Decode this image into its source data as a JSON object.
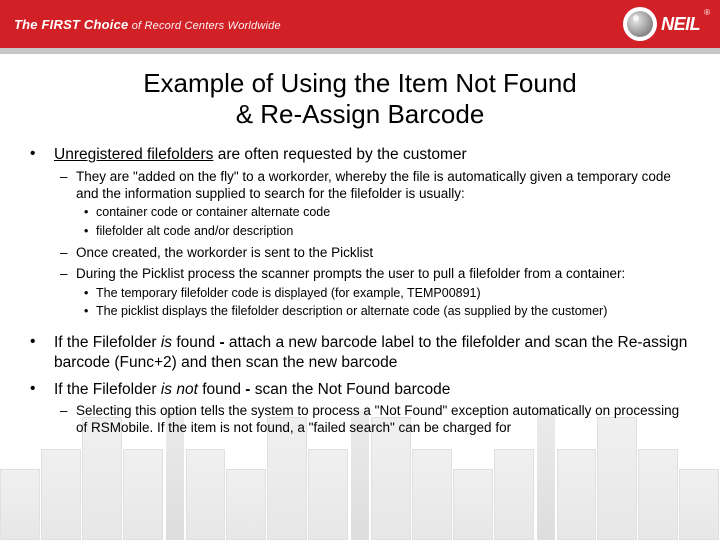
{
  "header": {
    "tagline_first": "The FIRST Choice",
    "tagline_rest": " of Record Centers Worldwide",
    "logo_text": "NEIL",
    "logo_reg": "®"
  },
  "title_l1": "Example of Using the Item Not Found",
  "title_l2": "& Re-Assign Barcode",
  "b1": {
    "heading_pre": "Unregistered filefolders",
    "heading_post": " are often requested by the customer",
    "s1": "They are \"added on the fly\" to a workorder, whereby the file is automatically given a temporary code and the information supplied to search for the filefolder is usually:",
    "s1a": "container code or container alternate code",
    "s1b": "filefolder alt code and/or description",
    "s2": "Once created, the workorder is sent to the Picklist",
    "s3": "During the Picklist process the scanner prompts the user to pull a filefolder from a container:",
    "s3a": "The temporary filefolder code is displayed (for example, TEMP00891)",
    "s3b": "The picklist displays the filefolder description or alternate code (as supplied by the customer)"
  },
  "b2": {
    "pre": "If the Filefolder ",
    "is": "is",
    "mid1": " found ",
    "dash": "-",
    "post": " attach a new barcode label to the filefolder and scan the Re-assign barcode (Func+2) and then scan the new barcode"
  },
  "b3": {
    "pre": "If the Filefolder ",
    "isnot": "is not",
    "mid1": " found ",
    "dash": "-",
    "post": " scan the Not Found barcode",
    "s1": "Selecting this option tells the system to process a \"Not Found\" exception automatically on processing of RSMobile.  If the item is not found, a \"failed search\" can be charged for"
  }
}
